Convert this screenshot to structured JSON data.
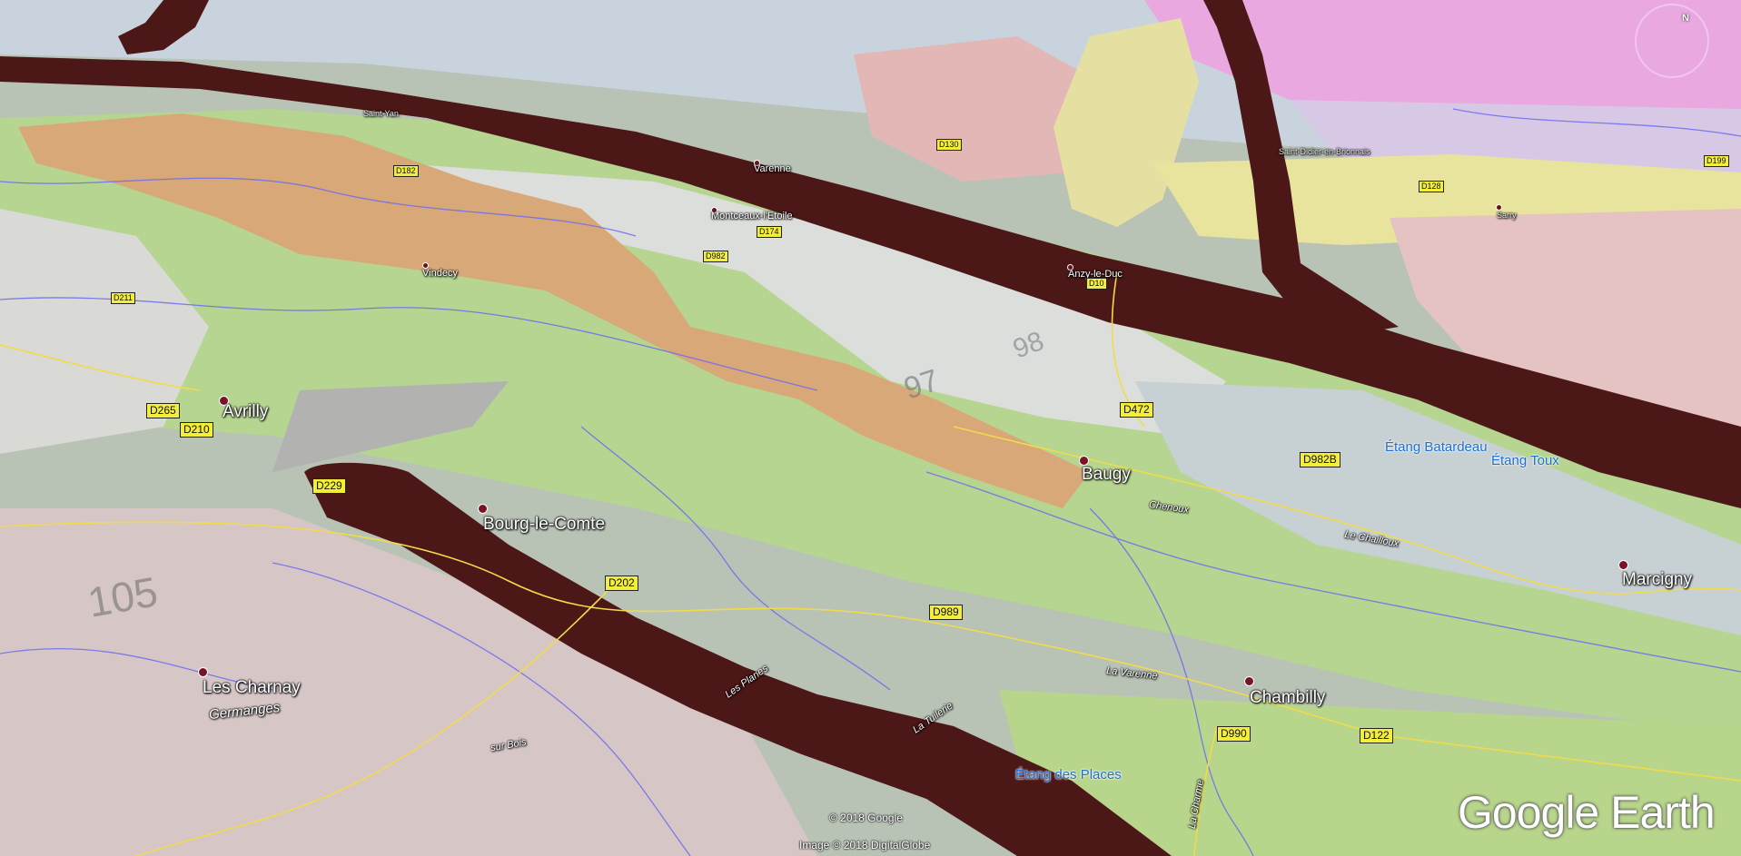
{
  "branding": {
    "logo_text": "Google Earth"
  },
  "credits": {
    "copyright": "© 2018 Google",
    "imagery": "Image © 2018 DigitalGlobe"
  },
  "compass": {
    "north_label": "N"
  },
  "places": {
    "avrilly": "Avrilly",
    "bourg_le_comte": "Bourg-le-Comte",
    "les_charnay": "Les Charnay",
    "germanges": "Germanges",
    "baugy": "Baugy",
    "chambilly": "Chambilly",
    "marcigny": "Marcigny",
    "vindecy": "Vindecy",
    "montceaux_letoile": "Montceaux-l'Etoile",
    "varenne": "Varenne",
    "anzy_le_duc": "Anzy-le-Duc",
    "saint_didier": "Saint-Didier-en-Brionnais",
    "sarry": "Sarry",
    "saint_yan": "Saint-Yan",
    "chenoux": "Chenoux",
    "le_chailloux": "Le Chailloux",
    "la_varenne": "La Varenne",
    "les_planes": "Les Planes",
    "la_tuilerie": "La Tuilerie",
    "la_charme": "La Charme",
    "sur_bois": "sur Bois"
  },
  "water": {
    "etang_batardeau": "Étang Batardeau",
    "etang_toux": "Étang Toux",
    "etang_des_places": "Étang des Places"
  },
  "roads": {
    "d211": "D211",
    "d265": "D265",
    "d210": "D210",
    "d229": "D229",
    "d202": "D202",
    "d989": "D989",
    "d472": "D472",
    "d982b": "D982B",
    "d990": "D990",
    "d122": "D122",
    "d982": "D982",
    "d174": "D174",
    "d10": "D10",
    "d130": "D130",
    "d128": "D128",
    "d199": "D199",
    "d182": "D182"
  },
  "geology_codes": {
    "a": "97",
    "b": "98",
    "c": "105"
  }
}
